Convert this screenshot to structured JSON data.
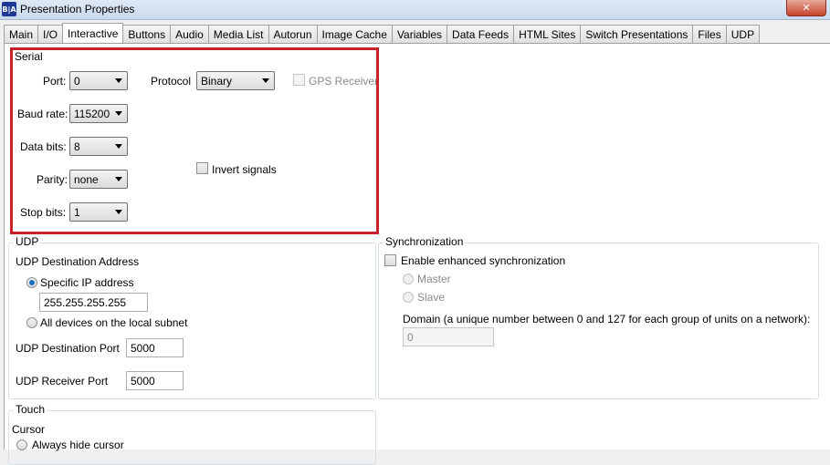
{
  "window": {
    "title": "Presentation Properties",
    "app_icon_text": "B|A",
    "close_symbol": "✕"
  },
  "tabs": [
    {
      "label": "Main"
    },
    {
      "label": "I/O"
    },
    {
      "label": "Interactive"
    },
    {
      "label": "Buttons"
    },
    {
      "label": "Audio"
    },
    {
      "label": "Media List"
    },
    {
      "label": "Autorun"
    },
    {
      "label": "Image Cache"
    },
    {
      "label": "Variables"
    },
    {
      "label": "Data Feeds"
    },
    {
      "label": "HTML Sites"
    },
    {
      "label": "Switch Presentations"
    },
    {
      "label": "Files"
    },
    {
      "label": "UDP"
    }
  ],
  "active_tab": "Interactive",
  "serial": {
    "title": "Serial",
    "port_label": "Port:",
    "port_value": "0",
    "protocol_label": "Protocol",
    "protocol_value": "Binary",
    "gps_label": "GPS Receiver",
    "baud_label": "Baud rate:",
    "baud_value": "115200",
    "databits_label": "Data bits:",
    "databits_value": "8",
    "parity_label": "Parity:",
    "parity_value": "none",
    "stopbits_label": "Stop bits:",
    "stopbits_value": "1",
    "invert_label": "Invert signals"
  },
  "udp": {
    "title": "UDP",
    "dest_address_label": "UDP Destination Address",
    "specific_ip_label": "Specific IP address",
    "ip_value": "255.255.255.255",
    "all_devices_label": "All devices on the local subnet",
    "dest_port_label": "UDP Destination Port",
    "dest_port_value": "5000",
    "receiver_port_label": "UDP Receiver Port",
    "receiver_port_value": "5000"
  },
  "sync": {
    "title": "Synchronization",
    "enable_label": "Enable enhanced synchronization",
    "master_label": "Master",
    "slave_label": "Slave",
    "domain_label": "Domain (a unique number between 0 and 127 for each group of units on a network):",
    "domain_value": "0"
  },
  "touch": {
    "title": "Touch",
    "cursor_label": "Cursor",
    "hide_cursor_label": "Always hide cursor"
  },
  "colors": {
    "highlight": "#c8232c",
    "radio_selected": "#1c6fc1"
  }
}
